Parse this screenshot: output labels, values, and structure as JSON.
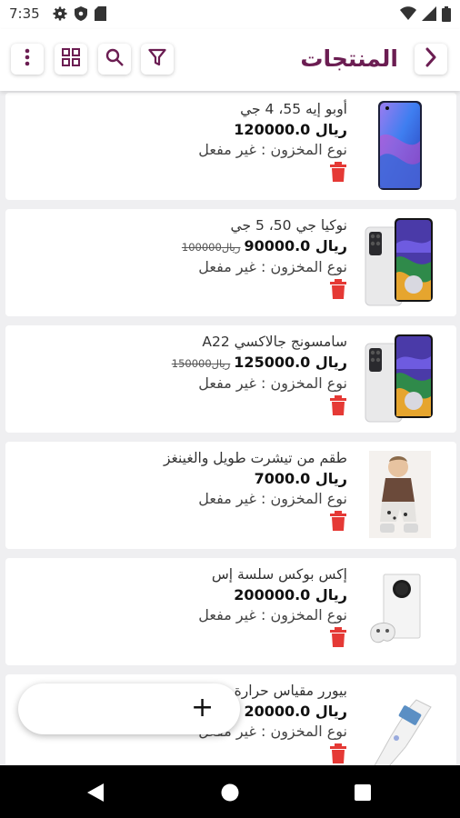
{
  "status_bar": {
    "time": "7:35",
    "icons": [
      "settings-icon",
      "shield-icon",
      "sd-card-icon",
      "wifi-icon",
      "signal-icon",
      "battery-icon"
    ]
  },
  "app_bar": {
    "title": "المنتجات",
    "buttons": [
      "back-chevron-icon",
      "filter-icon",
      "search-icon",
      "grid-icon",
      "more-vertical-icon"
    ]
  },
  "colors": {
    "accent": "#6b1d52",
    "delete": "#e53935",
    "background": "#efeff1"
  },
  "products": [
    {
      "name": "أوبو إيه 55، 4 جي",
      "price": "ريال 120000.0",
      "old_price": "",
      "stock": "نوع المخزون : غير مفعل",
      "image": "phone-blue"
    },
    {
      "name": "نوكيا جي 50، 5 جي",
      "price": "ريال 90000.0",
      "old_price": "ريال100000",
      "stock": "نوع المخزون : غير مفعل",
      "image": "phone-white"
    },
    {
      "name": "سامسونج جالاكسي A22",
      "price": "ريال 125000.0",
      "old_price": "ريال150000",
      "stock": "نوع المخزون : غير مفعل",
      "image": "phone-white"
    },
    {
      "name": "طقم من تيشرت طويل والغينغز",
      "price": "ريال 7000.0",
      "old_price": "",
      "stock": "نوع المخزون : غير مفعل",
      "image": "kids-outfit"
    },
    {
      "name": "إكس بوكس سلسة إس",
      "price": "ريال 200000.0",
      "old_price": "",
      "stock": "نوع المخزون : غير مفعل",
      "image": "xbox"
    },
    {
      "name": "بيورر مقياس حرارة",
      "price": "ريال 20000.0",
      "old_price": "",
      "stock": "نوع المخزون : غير مفعل",
      "image": "thermometer"
    }
  ],
  "fab": {
    "label": "+"
  },
  "nav_bar": {
    "icons": [
      "back-triangle-icon",
      "home-circle-icon",
      "recents-square-icon"
    ]
  }
}
